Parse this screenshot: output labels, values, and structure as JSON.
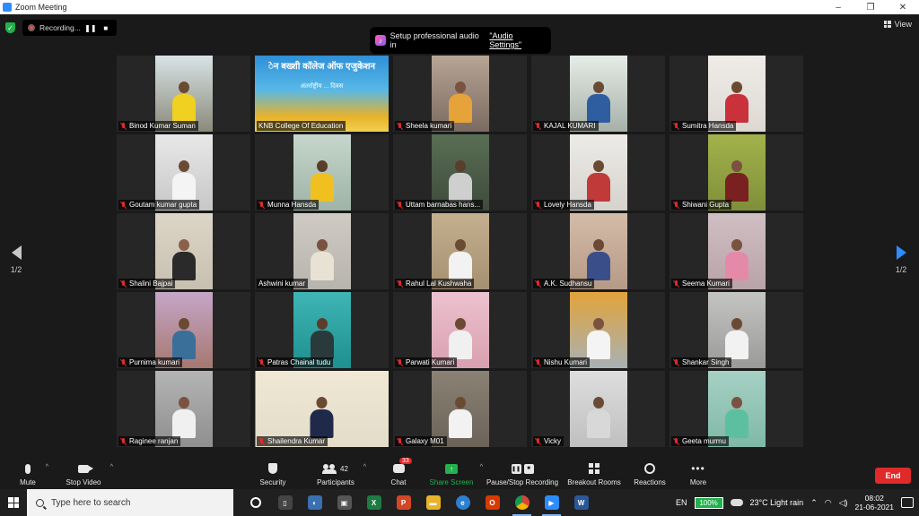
{
  "window": {
    "title": "Zoom Meeting",
    "controls": [
      "–",
      "❐",
      "✕"
    ]
  },
  "recording": {
    "label": "Recording...",
    "pause": "❚❚",
    "stop": "■"
  },
  "view": {
    "label": "View"
  },
  "audio_tip": {
    "text": "Setup professional audio in",
    "link": "\"Audio Settings\""
  },
  "pager": {
    "left": "1/2",
    "right": "1/2"
  },
  "banner_tile": {
    "line1": "ेन बख्शी कॉलेज ऑफ एजुकेशन",
    "line2": "अंतर्राष्ट्रीय ... दिवस"
  },
  "participants": [
    {
      "name": "Binod Kumar Suman",
      "muted": true,
      "bg": "#8a8a7a",
      "shirt": "#f0d020",
      "skin": "#6b4a34",
      "wall": "#d8e3e6"
    },
    {
      "name": "KNB College Of Education",
      "muted": false,
      "banner": true
    },
    {
      "name": "Sheela kumari",
      "muted": true,
      "bg": "#7a6a60",
      "shirt": "#e5a33a",
      "skin": "#7a5240",
      "wall": "#b7a595"
    },
    {
      "name": "KAJAL KUMARI",
      "muted": true,
      "bg": "#a6b0a8",
      "shirt": "#2f5ea0",
      "skin": "#6b4a34",
      "wall": "#e6ece7"
    },
    {
      "name": "Sumitra Hansda",
      "muted": true,
      "bg": "#ddd8d2",
      "shirt": "#c9323a",
      "skin": "#6b4a34",
      "wall": "#efece8"
    },
    {
      "name": "Goutam kumar gupta",
      "muted": true,
      "bg": "#c7c7c7",
      "shirt": "#f4f4f4",
      "skin": "#6b4a34",
      "wall": "#e8e8e8"
    },
    {
      "name": "Munna Hansda",
      "muted": true,
      "bg": "#9fb3a6",
      "shirt": "#f0c020",
      "skin": "#5a3d2b",
      "wall": "#c6d6cc"
    },
    {
      "name": "Uttam barnabas hans...",
      "muted": true,
      "bg": "#3f4a3c",
      "shirt": "#cfcfcf",
      "skin": "#5a3d2b",
      "wall": "#596f55"
    },
    {
      "name": "Lovely Hansda",
      "muted": true,
      "bg": "#d6d2cc",
      "shirt": "#c03a3a",
      "skin": "#6b4a34",
      "wall": "#ecebe8"
    },
    {
      "name": "Shiwani Gupta",
      "muted": true,
      "bg": "#7f8f3a",
      "shirt": "#7a2020",
      "skin": "#7a5240",
      "wall": "#a3b24a"
    },
    {
      "name": "Shalini Bajpai",
      "muted": true,
      "bg": "#c7c0b0",
      "shirt": "#2a2a2a",
      "skin": "#8a6048",
      "wall": "#ddd6c8"
    },
    {
      "name": "Ashwini kumar",
      "muted": false,
      "bg": "#b7b4ad",
      "shirt": "#e8e2d4",
      "skin": "#7a5240",
      "wall": "#cfcbc4"
    },
    {
      "name": "Rahul Lal Kushwaha",
      "muted": true,
      "bg": "#a59072",
      "shirt": "#f2f2f2",
      "skin": "#6b4a34",
      "wall": "#c4af8e"
    },
    {
      "name": "A.K. Sudhansu",
      "muted": true,
      "bg": "#b59a86",
      "shirt": "#3a4f8a",
      "skin": "#6b4a34",
      "wall": "#d4bca8"
    },
    {
      "name": "Seema Kumari",
      "muted": true,
      "bg": "#b9a3a8",
      "shirt": "#e48aa8",
      "skin": "#7a5240",
      "wall": "#cfbfc2"
    },
    {
      "name": "Purnima kumari",
      "muted": true,
      "bg": "#a5786f",
      "shirt": "#3a6f9a",
      "skin": "#6b4a34",
      "wall": "#c6a6c8"
    },
    {
      "name": "Patras Chainal tudu",
      "muted": true,
      "bg": "#1f8f8f",
      "shirt": "#2a3a3a",
      "skin": "#5a3d2b",
      "wall": "#3fb5b5"
    },
    {
      "name": "Parwati Kumari",
      "muted": true,
      "bg": "#d99fb0",
      "shirt": "#f0f0f0",
      "skin": "#6b4a34",
      "wall": "#ecc2cf"
    },
    {
      "name": "Nishu Kumari",
      "muted": true,
      "bg": "#a8b1b5",
      "shirt": "#f4f4f4",
      "skin": "#7a5240",
      "wall": "#e2a33a"
    },
    {
      "name": "Shankar Singh",
      "muted": true,
      "bg": "#9a9a98",
      "shirt": "#f2f2f2",
      "skin": "#6b4a34",
      "wall": "#c4c4c2"
    },
    {
      "name": "Raginee ranjan",
      "muted": true,
      "bg": "#8f8f8f",
      "shirt": "#f0f0f0",
      "skin": "#7a5240",
      "wall": "#b4b4b4"
    },
    {
      "name": "Shailendra Kumar",
      "muted": true,
      "bg": "#e3dcc9",
      "shirt": "#1f2a4a",
      "skin": "#6b4a34",
      "wall": "#efe8d4",
      "wide": true
    },
    {
      "name": "Galaxy M01",
      "muted": true,
      "bg": "#6b6358",
      "shirt": "#f2f2f2",
      "skin": "#6b4a34",
      "wall": "#8b8275"
    },
    {
      "name": "Vicky",
      "muted": true,
      "bg": "#bfbfbf",
      "shirt": "#d8d8d8",
      "skin": "#6b4a34",
      "wall": "#dedede"
    },
    {
      "name": "Geeta murmu",
      "muted": true,
      "bg": "#7fb8a6",
      "shirt": "#5cc0a0",
      "skin": "#7a5240",
      "wall": "#a6d1c4"
    }
  ],
  "toolbar": {
    "mute": "Mute",
    "stop_video": "Stop Video",
    "security": "Security",
    "participants": "Participants",
    "participants_count": "42",
    "chat": "Chat",
    "chat_badge": "33",
    "share_screen": "Share Screen",
    "pause_stop_recording": "Pause/Stop Recording",
    "breakout_rooms": "Breakout Rooms",
    "reactions": "Reactions",
    "more": "More",
    "end": "End"
  },
  "taskbar": {
    "search_placeholder": "Type here to search",
    "lang": "EN",
    "battery": "100%",
    "weather": "23°C  Light rain",
    "time": "08:02",
    "date": "21-06-2021"
  },
  "colors": {
    "accent": "#2d8cff",
    "end": "#e02a2a",
    "share": "#23b14d",
    "active_speaker": "#e0e84a"
  }
}
